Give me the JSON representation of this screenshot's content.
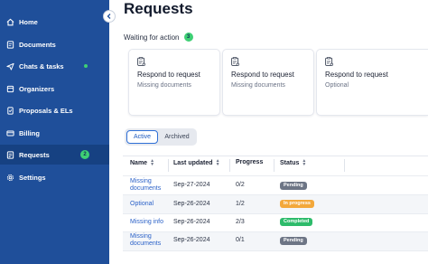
{
  "sidebar": {
    "items": [
      {
        "label": "Home",
        "icon": "home-icon"
      },
      {
        "label": "Documents",
        "icon": "document-icon"
      },
      {
        "label": "Chats & tasks",
        "icon": "send-icon"
      },
      {
        "label": "Organizers",
        "icon": "organizer-icon"
      },
      {
        "label": "Proposals & ELs",
        "icon": "proposal-icon"
      },
      {
        "label": "Billing",
        "icon": "billing-icon"
      },
      {
        "label": "Requests",
        "icon": "requests-icon",
        "badge": "2"
      },
      {
        "label": "Settings",
        "icon": "gear-icon"
      }
    ]
  },
  "page": {
    "title": "Requests",
    "waiting_label": "Waiting for action",
    "waiting_count": "3"
  },
  "cards": [
    {
      "title": "Respond to request",
      "subtitle": "Missing documents"
    },
    {
      "title": "Respond to request",
      "subtitle": "Missing documents"
    },
    {
      "title": "Respond to request",
      "subtitle": "Optional"
    }
  ],
  "tabs": {
    "active": "Active",
    "archived": "Archived"
  },
  "table": {
    "headers": {
      "name": "Name",
      "last_updated": "Last updated",
      "progress": "Progress",
      "status": "Status"
    },
    "rows": [
      {
        "name": "Missing documents",
        "date": "Sep-27-2024",
        "progress": "0/2",
        "status": "Pending"
      },
      {
        "name": "Optional",
        "date": "Sep-26-2024",
        "progress": "1/2",
        "status": "In progress"
      },
      {
        "name": "Missing info",
        "date": "Sep-26-2024",
        "progress": "2/3",
        "status": "Completed"
      },
      {
        "name": "Missing documents",
        "date": "Sep-26-2024",
        "progress": "0/1",
        "status": "Pending"
      }
    ]
  },
  "colors": {
    "sidebar": "#1f4f9a",
    "accent": "#2f6fd6",
    "pending": "#6d7585",
    "in_progress": "#f3a83b",
    "completed": "#2dbb6a"
  }
}
